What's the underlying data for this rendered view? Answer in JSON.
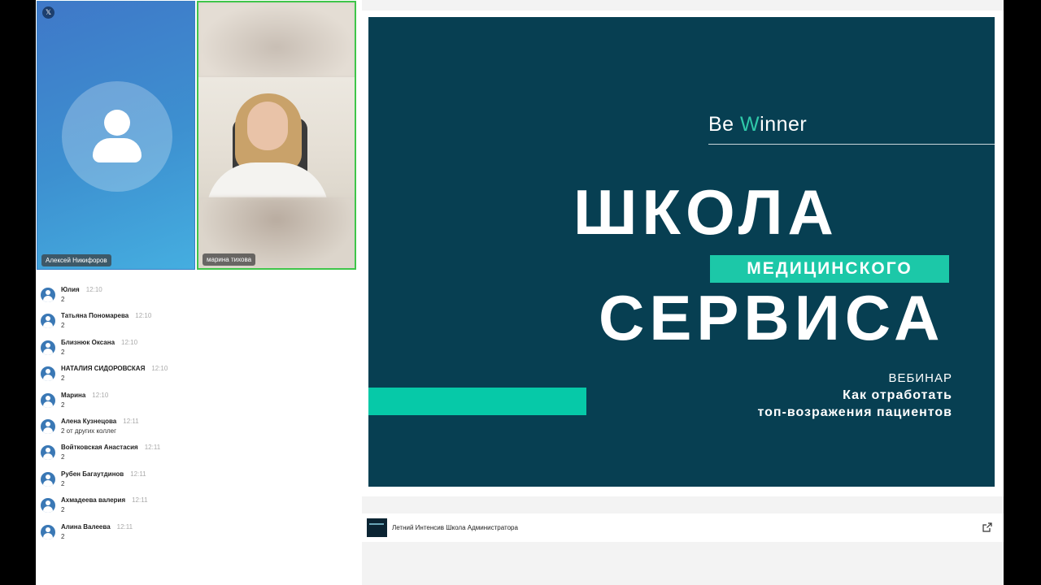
{
  "participants": [
    {
      "name": "Алексей Никифоров",
      "badge": "𝕏"
    },
    {
      "name": "марина тихова"
    }
  ],
  "chat": [
    {
      "name": "Юлия",
      "time": "12:10",
      "text": "2"
    },
    {
      "name": "Татьяна Пономарева",
      "time": "12:10",
      "text": "2"
    },
    {
      "name": "Близнюк Оксана",
      "time": "12:10",
      "text": "2"
    },
    {
      "name": "НАТАЛИЯ СИДОРОВСКАЯ",
      "time": "12:10",
      "text": "2"
    },
    {
      "name": "Марина",
      "time": "12:10",
      "text": "2"
    },
    {
      "name": "Алена Кузнецова",
      "time": "12:11",
      "text": "2 от других коллег"
    },
    {
      "name": "Войтковская Анастасия",
      "time": "12:11",
      "text": "2"
    },
    {
      "name": "Рубен Багаутдинов",
      "time": "12:11",
      "text": "2"
    },
    {
      "name": "Ахмадеева валерия",
      "time": "12:11",
      "text": "2"
    },
    {
      "name": "Алина Валеева",
      "time": "12:11",
      "text": "2"
    }
  ],
  "slide": {
    "brand_prefix": "Be ",
    "brand_w": "W",
    "brand_suffix": "inner",
    "title1": "ШКОЛА",
    "highlight": "МЕДИЦИНСКОГО",
    "title2": "СЕРВИСА",
    "webinar_label": "ВЕБИНАР",
    "webinar_line1": "Как отработать",
    "webinar_line2": "топ-возражения пациентов",
    "colors": {
      "background": "#073f52",
      "accent": "#1cc8a8"
    }
  },
  "link": {
    "title": "Летний Интенсив Школа Администратора",
    "icon": "external-link-icon"
  }
}
